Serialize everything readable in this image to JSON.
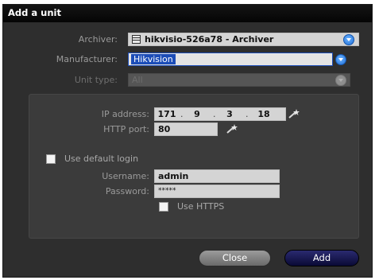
{
  "dialog": {
    "title": "Add a unit"
  },
  "form": {
    "archiver_label": "Archiver:",
    "archiver_value": "hikvisio-526a78 - Archiver",
    "manufacturer_label": "Manufacturer:",
    "manufacturer_value": "Hikvision",
    "unit_type_label": "Unit type:",
    "unit_type_value": "All"
  },
  "connection": {
    "ip_label": "IP address:",
    "ip_octets": [
      "171",
      "9",
      "3",
      "18"
    ],
    "ip_separator": ".",
    "http_port_label": "HTTP port:",
    "http_port_value": "80",
    "use_default_login_label": "Use default login",
    "use_default_login_checked": false,
    "username_label": "Username:",
    "username_value": "admin",
    "password_label": "Password:",
    "password_value": "*****",
    "use_https_label": "Use HTTPS",
    "use_https_checked": false
  },
  "buttons": {
    "close": "Close",
    "add": "Add"
  },
  "icons": {
    "archiver": "server-icon",
    "dropdown": "chevron-down-icon",
    "tool": "wand-icon"
  },
  "colors": {
    "dialog_bg": "#2e2e2e",
    "panel_bg": "#3b3b3b",
    "accent_blue": "#1f6fd9",
    "selection": "#1c4db8",
    "add_button": "#12124a"
  }
}
